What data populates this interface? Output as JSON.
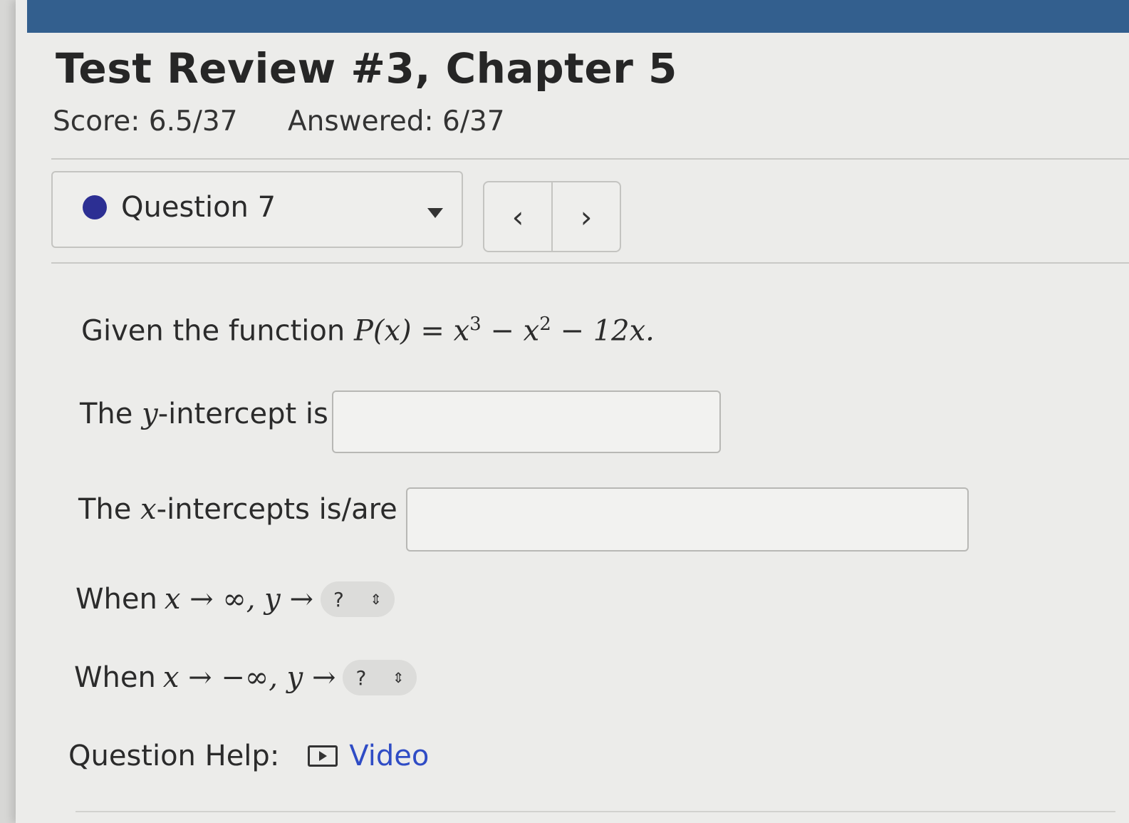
{
  "header": {
    "title": "Test Review #3, Chapter 5",
    "score": "Score: 6.5/37",
    "answered": "Answered: 6/37"
  },
  "question_nav": {
    "current": "Question 7",
    "prev_label": "‹",
    "next_label": "›"
  },
  "question": {
    "intro": "Given the function ",
    "function": {
      "lhs": "P(x)",
      "eq": " = ",
      "t1": "x",
      "e1": "3",
      "t2": " − x",
      "e2": "2",
      "t3": " − 12x."
    },
    "y_intercept": {
      "pre": "The ",
      "var": "y",
      "post": "-intercept is",
      "value": ""
    },
    "x_intercepts": {
      "pre": "The ",
      "var": "x",
      "post": "-intercepts is/are",
      "value": ""
    },
    "end_pos": {
      "when": "When ",
      "expr": "x → ∞, y → ",
      "selected": "?"
    },
    "end_neg": {
      "when": "When ",
      "expr": "x → −∞, y → ",
      "selected": "?"
    }
  },
  "help": {
    "label": "Question Help:",
    "video": "Video"
  }
}
